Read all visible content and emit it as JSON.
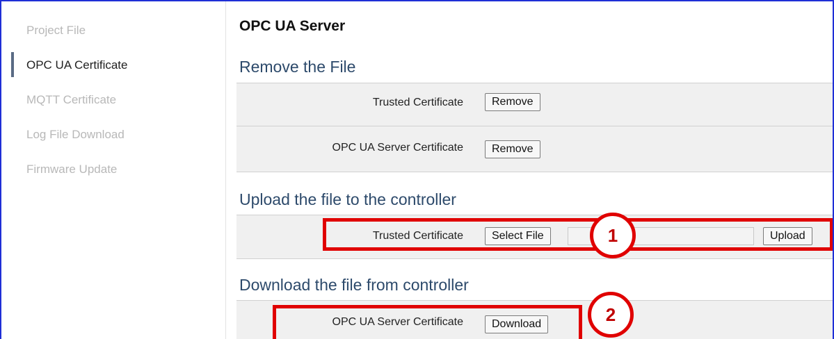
{
  "sidebar": {
    "items": [
      {
        "label": "Project File"
      },
      {
        "label": "OPC UA Certificate",
        "active": true
      },
      {
        "label": "MQTT Certificate"
      },
      {
        "label": "Log File Download"
      },
      {
        "label": "Firmware Update"
      }
    ]
  },
  "main": {
    "title": "OPC UA Server",
    "remove_section": {
      "heading": "Remove the File",
      "rows": [
        {
          "label": "Trusted Certificate",
          "button": "Remove"
        },
        {
          "label": "OPC UA Server Certificate",
          "button": "Remove"
        }
      ]
    },
    "upload_section": {
      "heading": "Upload the file to the controller",
      "row": {
        "label": "Trusted Certificate",
        "select_button": "Select File",
        "file_value": "",
        "upload_button": "Upload"
      }
    },
    "download_section": {
      "heading": "Download the file from controller",
      "row": {
        "label": "OPC UA Server Certificate",
        "button": "Download"
      }
    }
  },
  "callouts": [
    {
      "number": "1"
    },
    {
      "number": "2"
    }
  ],
  "colors": {
    "callout": "#e00000",
    "frame_border": "#1f2fd6",
    "section_heading": "#2d4a6b",
    "active_indicator": "#5a6b84"
  }
}
